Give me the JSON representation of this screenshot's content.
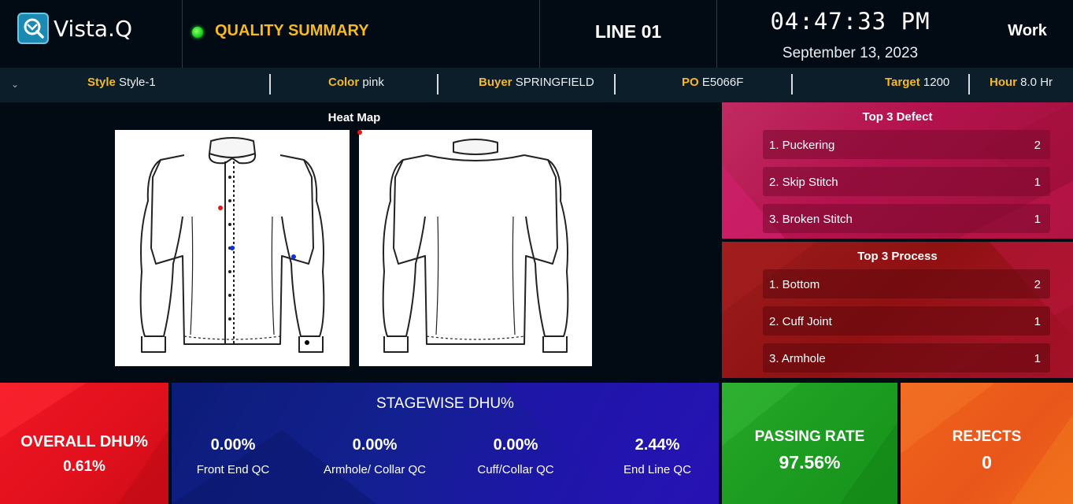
{
  "header": {
    "app_name": "Vista.Q",
    "summary_title": "QUALITY SUMMARY",
    "line": "LINE 01",
    "time": "04:47:33 PM",
    "date": "September 13, 2023",
    "mode": "Work",
    "status_color": "#1bd11b"
  },
  "info": {
    "style_label": "Style",
    "style_value": "Style-1",
    "color_label": "Color",
    "color_value": "pink",
    "buyer_label": "Buyer",
    "buyer_value": "SPRINGFIELD",
    "po_label": "PO",
    "po_value": "E5066F",
    "target_label": "Target",
    "target_value": "1200",
    "hour_label": "Hour",
    "hour_value": "8.0 Hr"
  },
  "heatmap": {
    "title": "Heat Map",
    "marker_colors": [
      "#e11",
      "#1030e0",
      "#000"
    ]
  },
  "top_defects": {
    "title": "Top 3 Defect",
    "items": [
      {
        "label": "1. Puckering",
        "count": "2"
      },
      {
        "label": "2. Skip Stitch",
        "count": "1"
      },
      {
        "label": "3. Broken Stitch",
        "count": "1"
      }
    ]
  },
  "top_process": {
    "title": "Top 3 Process",
    "items": [
      {
        "label": "1. Bottom",
        "count": "2"
      },
      {
        "label": "2. Cuff Joint",
        "count": "1"
      },
      {
        "label": "3. Armhole",
        "count": "1"
      }
    ]
  },
  "overall": {
    "label": "OVERALL DHU%",
    "value": "0.61%"
  },
  "stagewise": {
    "title": "STAGEWISE DHU%",
    "stages": [
      {
        "value": "0.00%",
        "label": "Front End QC"
      },
      {
        "value": "0.00%",
        "label": "Armhole/ Collar QC"
      },
      {
        "value": "0.00%",
        "label": "Cuff/Collar QC"
      },
      {
        "value": "2.44%",
        "label": "End Line QC"
      }
    ]
  },
  "passing": {
    "label": "PASSING RATE",
    "value": "97.56%"
  },
  "rejects": {
    "label": "REJECTS",
    "value": "0"
  },
  "colors": {
    "accent_yellow": "#f6b91f",
    "defect_panel": "#b3124d",
    "process_panel": "#8f1111",
    "overall_tile": "#e0101c",
    "stagewise_tile": "#132090",
    "passing_tile": "#1a9a1e",
    "rejects_tile": "#e9561a"
  }
}
